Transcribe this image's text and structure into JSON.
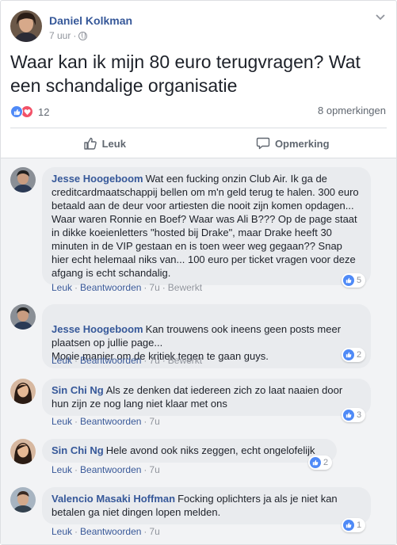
{
  "post": {
    "author": "Daniel Kolkman",
    "time": "7 uur",
    "time_separator": "·",
    "text": "Waar kan ik mijn 80 euro terugvragen? Wat een schandalige organisatie",
    "reaction_count": "12",
    "comments_label": "8 opmerkingen",
    "like_label": "Leuk",
    "comment_label": "Opmerking",
    "reaction_icons": [
      "like-icon",
      "love-icon"
    ]
  },
  "colors": {
    "link": "#365899",
    "like_blue": "#4f8af7",
    "love_red": "#f25268",
    "bubble": "#e9ebee"
  },
  "comments": [
    {
      "name": "Jesse Hoogeboom",
      "text": "Wat een fucking onzin Club Air. Ik ga de creditcardmaatschappij bellen om m'n geld terug te halen. 300 euro betaald aan de deur voor artiesten die nooit zijn komen opdagen... Waar waren Ronnie en Boef? Waar was Ali B??? Op de page staat in dikke koeienletters \"hosted bij Drake\", maar Drake heeft 30 minuten in de VIP gestaan en is toen weer weg gegaan?? Snap hier echt helemaal niks van... 100 euro per ticket vragen voor deze afgang is echt schandalig.",
      "like": "Leuk",
      "reply": "Beantwoorden",
      "time": "7u",
      "edited": "Bewerkt",
      "reactions": "5"
    },
    {
      "name": "Jesse Hoogeboom",
      "text": "Kan trouwens ook ineens geen posts meer plaatsen op jullie page...\nMooie manier om de kritiek tegen te gaan guys.",
      "like": "Leuk",
      "reply": "Beantwoorden",
      "time": "7u",
      "edited": "Bewerkt",
      "reactions": "2"
    },
    {
      "name": "Sin Chi Ng",
      "text": "Als ze denken dat iedereen zich zo laat naaien door hun zijn ze nog lang niet klaar met ons",
      "like": "Leuk",
      "reply": "Beantwoorden",
      "time": "7u",
      "reactions": "3"
    },
    {
      "name": "Sin Chi Ng",
      "text": "Hele avond ook niks zeggen, echt ongelofelijk",
      "like": "Leuk",
      "reply": "Beantwoorden",
      "time": "7u",
      "reactions": "2"
    },
    {
      "name": "Valencio Masaki Hoffman",
      "text": "Focking oplichters ja als je niet kan betalen ga niet dingen lopen melden.",
      "like": "Leuk",
      "reply": "Beantwoorden",
      "time": "7u",
      "reactions": "1"
    }
  ]
}
